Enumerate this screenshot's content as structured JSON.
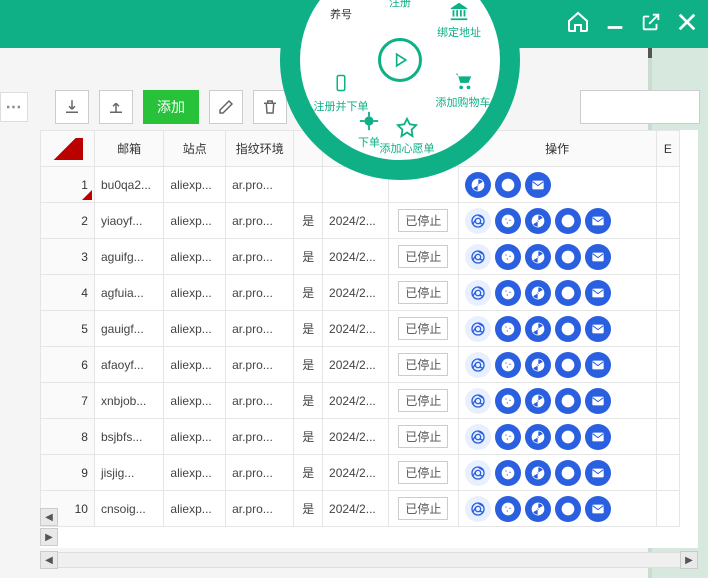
{
  "colors": {
    "brand": "#0fb086",
    "accent": "#2a5fe0",
    "add": "#28c23a"
  },
  "toolbar": {
    "download": "download-icon",
    "upload": "upload-icon",
    "add_label": "添加",
    "edit": "edit-icon",
    "delete": "trash-icon"
  },
  "radial": {
    "account_label": "养号",
    "register_label": "注册",
    "bind_address_label": "绑定地址",
    "add_cart_label": "添加购物车",
    "wishlist_label": "添加心愿单",
    "order_label": "下单",
    "register_order_label": "注册并下单",
    "play": "play-icon"
  },
  "table": {
    "headers": {
      "mail": "邮箱",
      "site": "站点",
      "env": "指纹环境",
      "tag": "",
      "date": "",
      "status": "",
      "ops": "操作",
      "extra": "E"
    },
    "status_label": "已停止",
    "common": {
      "site": "aliexp...",
      "env": "ar.pro...",
      "tag": "是"
    },
    "rows": [
      {
        "n": "1",
        "mail": "bu0qa2...",
        "date": "",
        "status": ""
      },
      {
        "n": "2",
        "mail": "yiaoyf...",
        "date": "2024/2...",
        "status": "已停止"
      },
      {
        "n": "3",
        "mail": "aguifg...",
        "date": "2024/2...",
        "status": "已停止"
      },
      {
        "n": "4",
        "mail": "agfuia...",
        "date": "2024/2...",
        "status": "已停止"
      },
      {
        "n": "5",
        "mail": "gauigf...",
        "date": "2024/2...",
        "status": "已停止"
      },
      {
        "n": "6",
        "mail": "afaoyf...",
        "date": "2024/2...",
        "status": "已停止"
      },
      {
        "n": "7",
        "mail": "xnbjob...",
        "date": "2024/2...",
        "status": "已停止"
      },
      {
        "n": "8",
        "mail": "bsjbfs...",
        "date": "2024/2...",
        "status": "已停止"
      },
      {
        "n": "9",
        "mail": "jisjig...",
        "date": "2024/2...",
        "status": "已停止"
      },
      {
        "n": "10",
        "mail": "cnsoig...",
        "date": "2024/2...",
        "status": "已停止"
      }
    ]
  }
}
